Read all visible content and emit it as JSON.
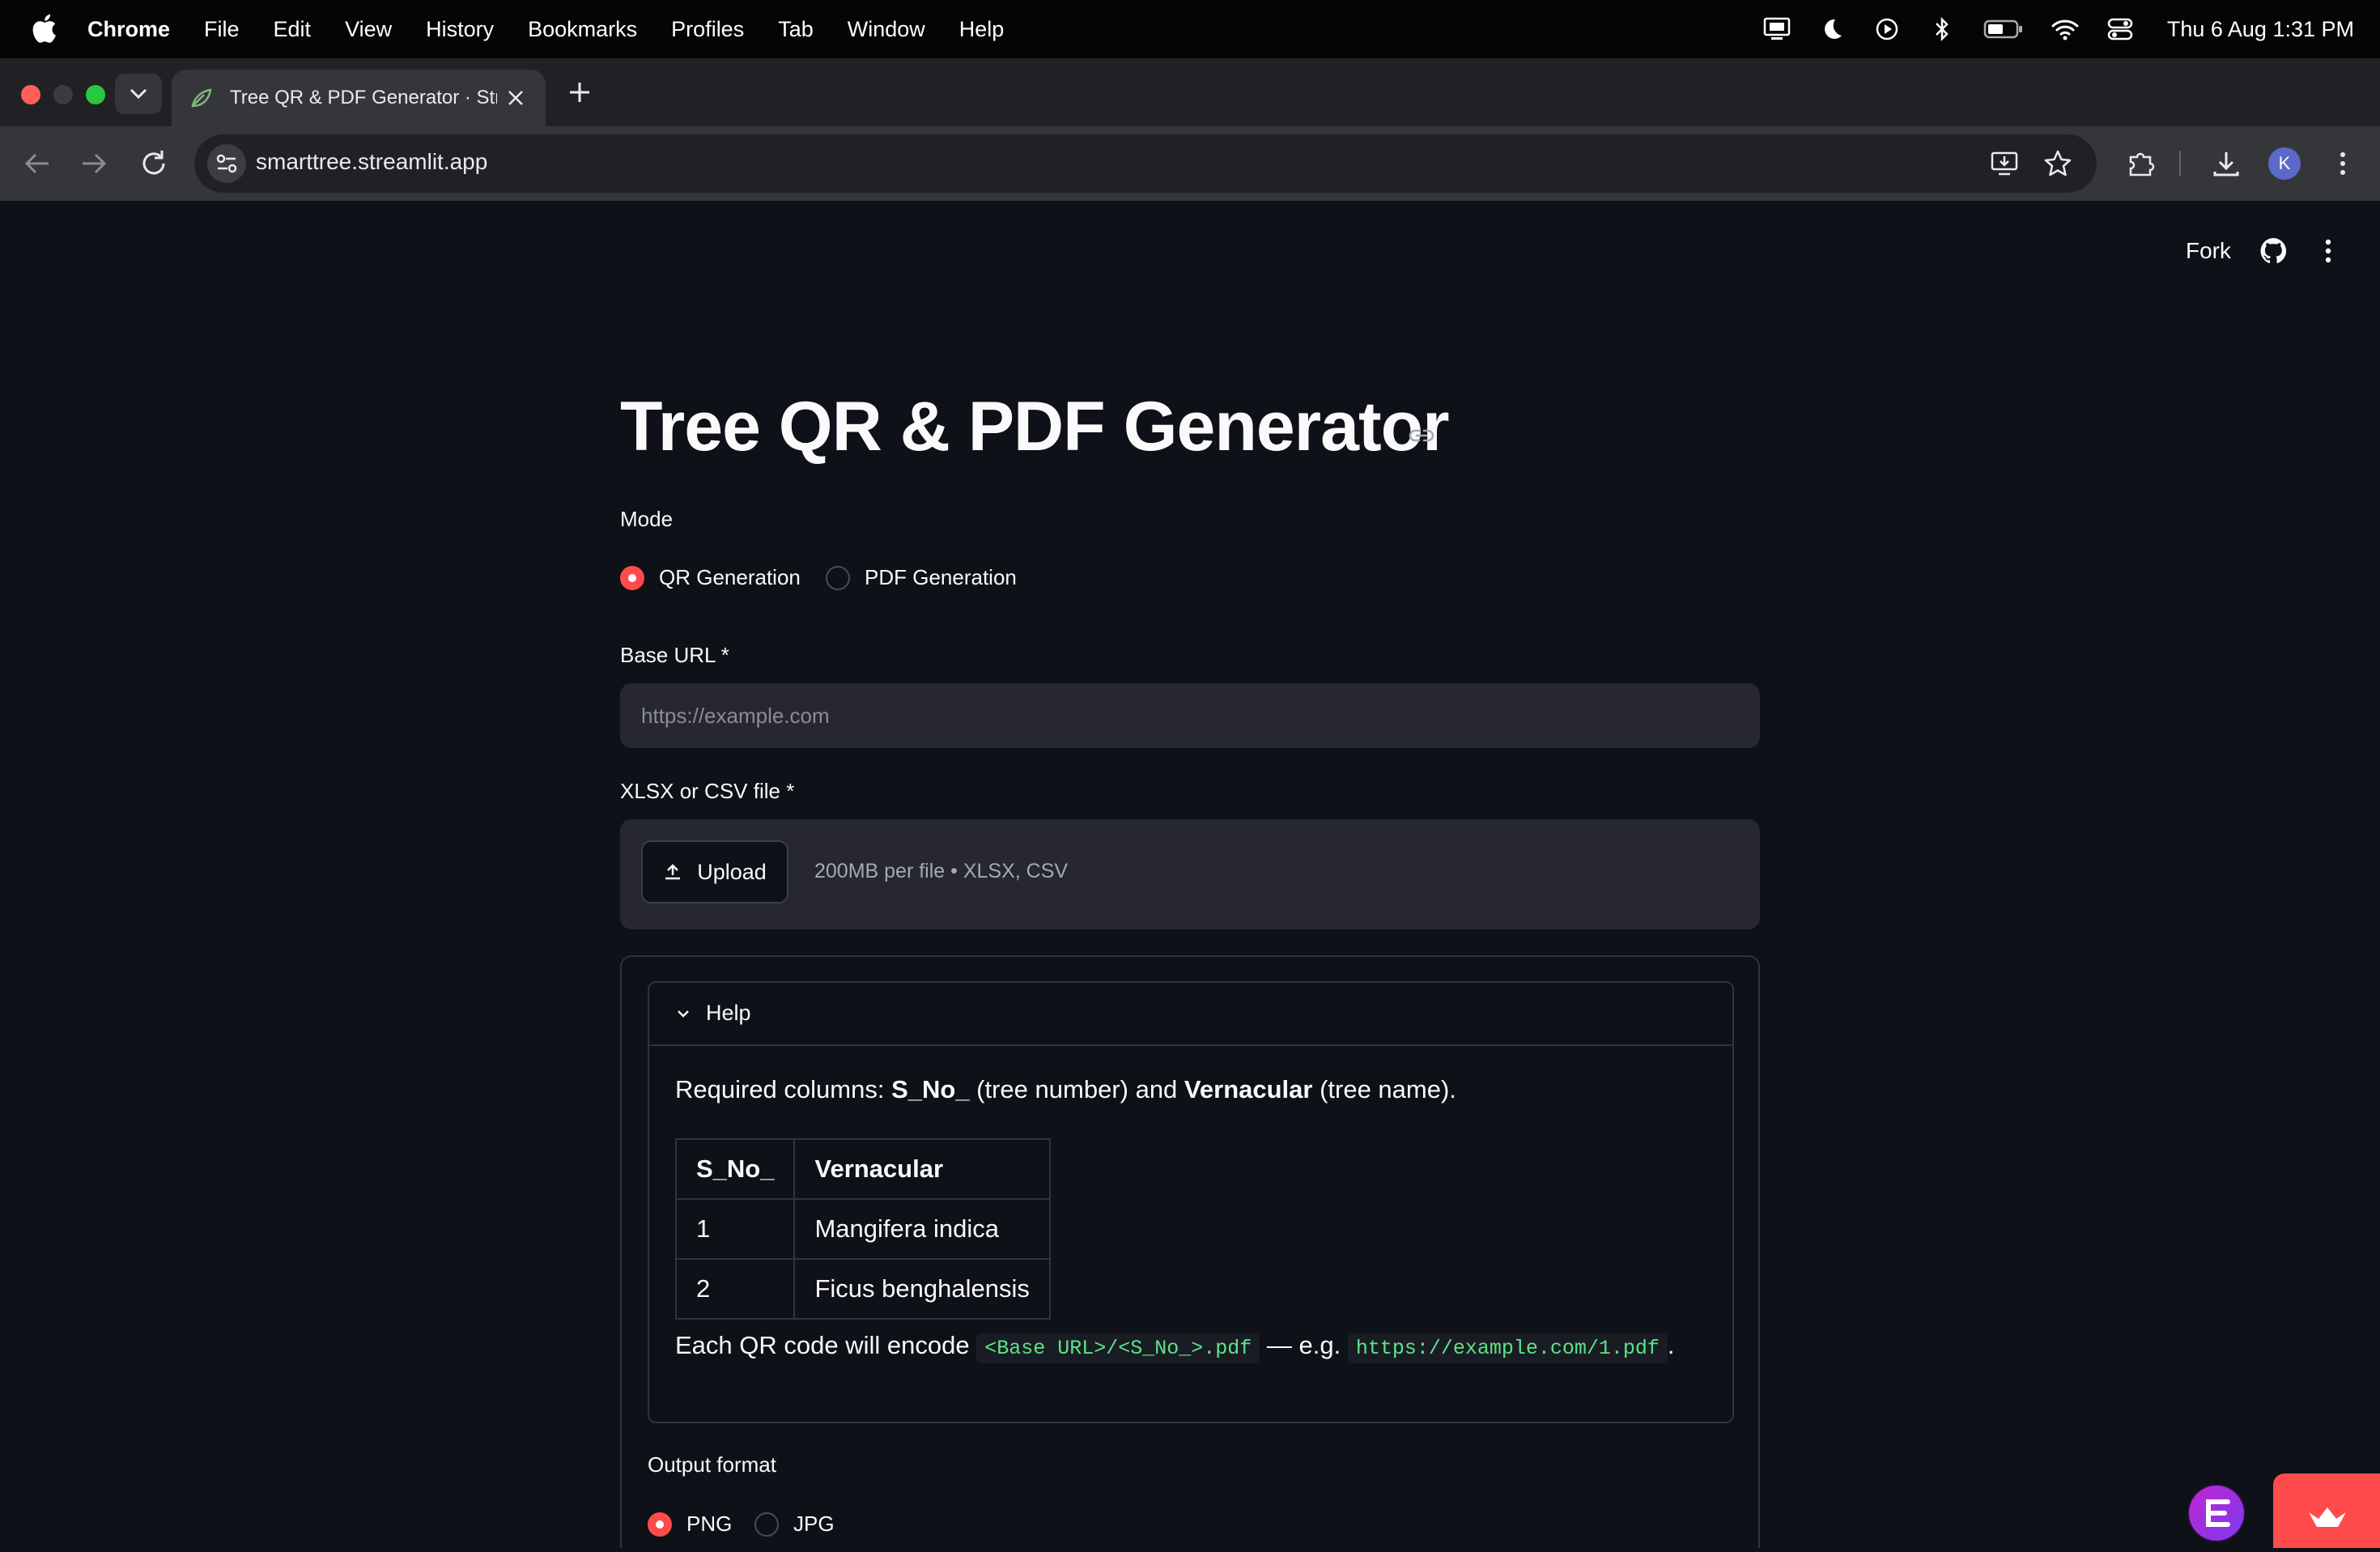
{
  "macos_menubar": {
    "app_name": "Chrome",
    "menus": [
      "File",
      "Edit",
      "View",
      "History",
      "Bookmarks",
      "Profiles",
      "Tab",
      "Window",
      "Help"
    ],
    "status_icons": [
      "display-icon",
      "moon-icon",
      "play-circle-icon",
      "bluetooth-icon",
      "battery-icon",
      "wifi-icon",
      "control-center-icon"
    ],
    "clock": "Thu 6 Aug  1:31 PM"
  },
  "browser": {
    "tab_title": "Tree QR & PDF Generator · Streamlit",
    "url": "smarttree.streamlit.app",
    "profile_initial": "K",
    "traffic_colors": [
      "#ff5f57",
      "#3c3c3c",
      "#28c840"
    ]
  },
  "app_header": {
    "fork_label": "Fork"
  },
  "main": {
    "title": "Tree QR & PDF Generator",
    "mode": {
      "label": "Mode",
      "options": [
        "QR Generation",
        "PDF Generation"
      ],
      "selected": "QR Generation"
    },
    "base_url": {
      "label": "Base URL *",
      "placeholder": "https://example.com",
      "value": ""
    },
    "file_upload": {
      "label": "XLSX or CSV file *",
      "button_label": "Upload",
      "hint": "200MB per file • XLSX, CSV"
    },
    "help": {
      "title": "Help",
      "required_prefix": "Required columns: ",
      "col1": "S_No_",
      "col1_desc": " (tree number) and ",
      "col2": "Vernacular",
      "col2_desc": " (tree name).",
      "table": {
        "headers": [
          "S_No_",
          "Vernacular"
        ],
        "rows": [
          [
            "1",
            "Mangifera indica"
          ],
          [
            "2",
            "Ficus benghalensis"
          ]
        ]
      },
      "encode_prefix": "Each QR code will encode ",
      "encode_pattern": "<Base URL>/<S_No_>.pdf",
      "encode_mid": " — e.g. ",
      "encode_example": "https://example.com/1.pdf",
      "encode_suffix": "."
    },
    "output_format": {
      "label": "Output format",
      "options": [
        "PNG",
        "JPG"
      ],
      "selected": "PNG"
    }
  },
  "colors": {
    "accent": "#ff4b4b",
    "background": "#0e1117",
    "input_bg": "#262730",
    "code_text": "#5ce488"
  }
}
